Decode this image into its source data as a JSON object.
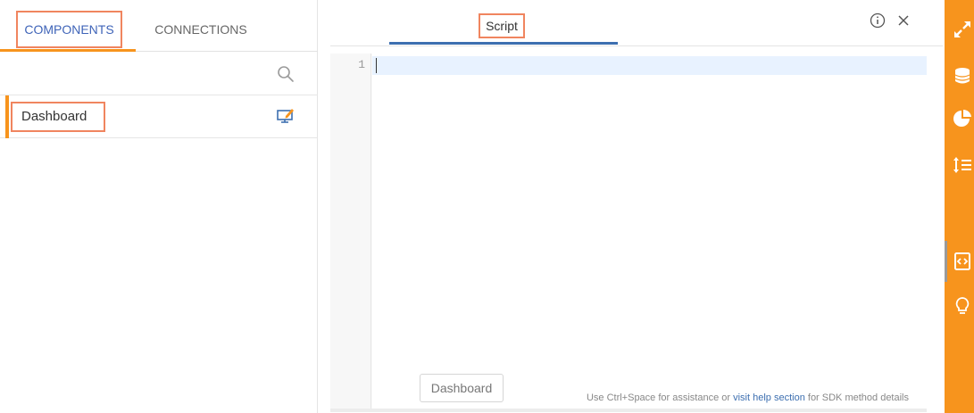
{
  "left_panel": {
    "tabs": [
      {
        "label": "COMPONENTS",
        "active": true
      },
      {
        "label": "CONNECTIONS",
        "active": false
      }
    ],
    "search": {
      "icon": "search-icon"
    },
    "components": [
      {
        "label": "Dashboard",
        "icon": "monitor-edit-icon"
      }
    ]
  },
  "script_panel": {
    "tab_label": "Script",
    "header_icons": [
      "info-icon",
      "close-icon"
    ],
    "editor": {
      "line_numbers": [
        "1"
      ],
      "content": ""
    },
    "context_button_label": "Dashboard",
    "help": {
      "prefix": "Use Ctrl+Space for assistance or ",
      "link": "visit help section",
      "suffix": " for SDK method details"
    }
  },
  "right_toolbar": {
    "icons": [
      "expand-icon",
      "database-icon",
      "pie-chart-icon",
      "sort-list-icon",
      "script-icon",
      "lightbulb-icon"
    ],
    "active": "script-icon"
  },
  "colors": {
    "accent_orange": "#f7941d",
    "tab_blue": "#3f64b8",
    "highlight_border": "#f0855f",
    "active_line": "#e8f2ff"
  }
}
